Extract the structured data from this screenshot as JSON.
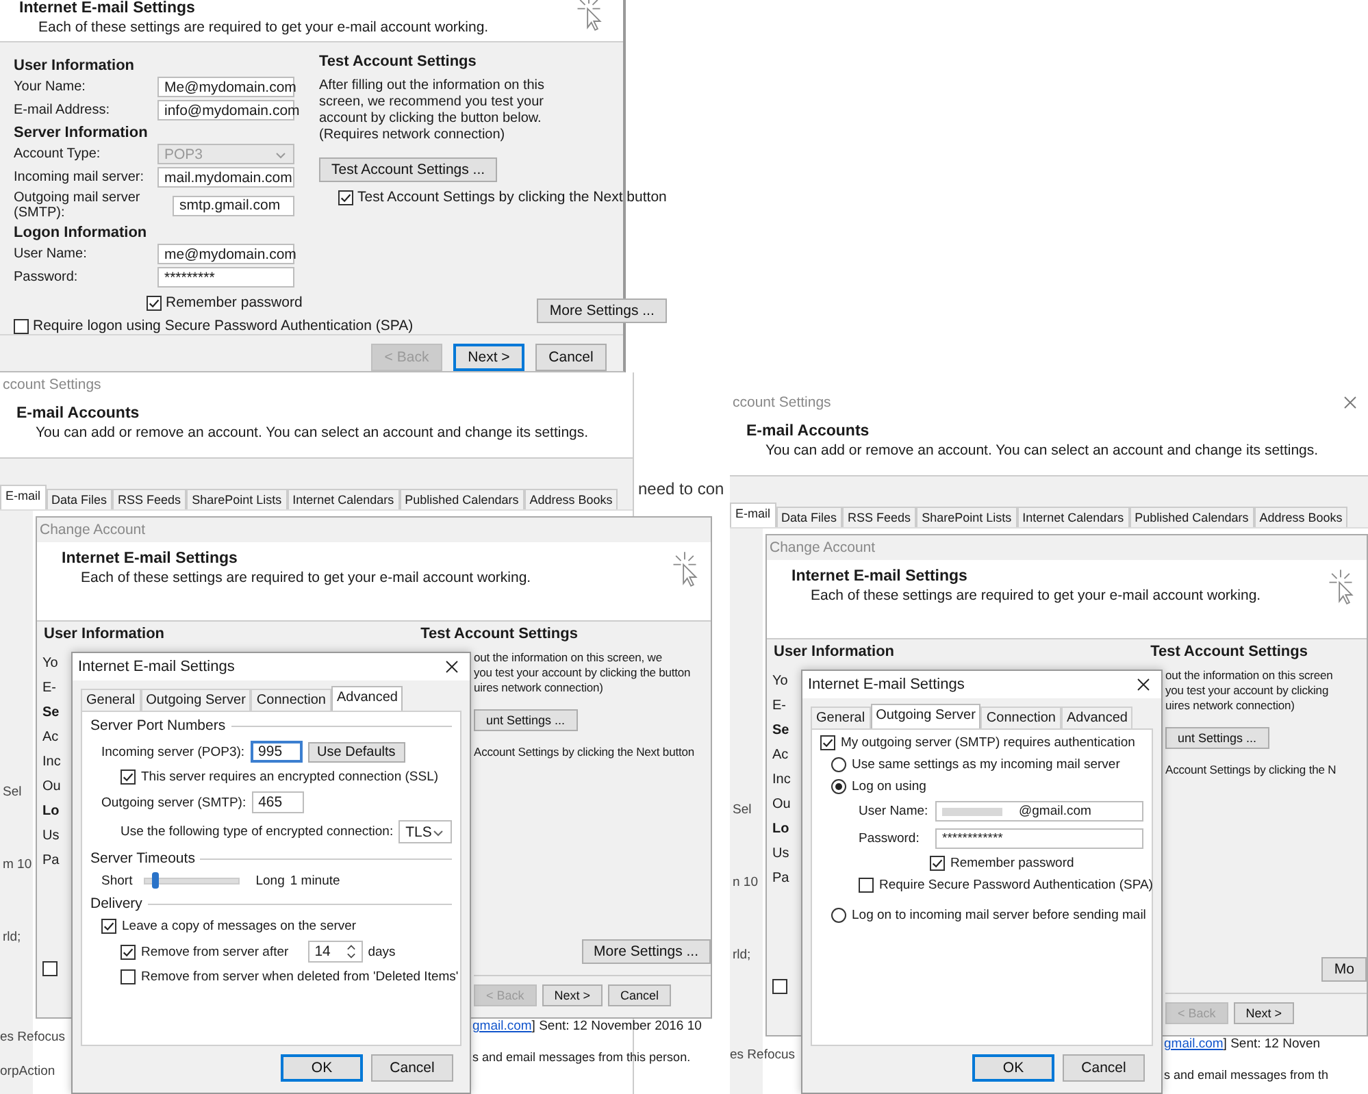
{
  "setup_dialog": {
    "heading": "Internet E-mail Settings",
    "description": "Each of these settings are required to get your e-mail account working.",
    "sections": [
      {
        "title": "User Information",
        "fields": [
          {
            "label": "Your Name:",
            "value": "Me@mydomain.com",
            "kind": "text",
            "disabled": false
          },
          {
            "label": "E-mail Address:",
            "value": "info@mydomain.com",
            "kind": "text",
            "disabled": false
          }
        ]
      },
      {
        "title": "Server Information",
        "fields": [
          {
            "label": "Account Type:",
            "value": "POP3",
            "kind": "select",
            "disabled": true
          },
          {
            "label": "Incoming mail server:",
            "value": "mail.mydomain.com",
            "kind": "text",
            "disabled": false
          },
          {
            "label": "Outgoing mail server (SMTP):",
            "value": "smtp.gmail.com",
            "kind": "text",
            "disabled": false
          }
        ]
      },
      {
        "title": "Logon Information",
        "fields": [
          {
            "label": "User Name:",
            "value": "me@mydomain.com",
            "kind": "text",
            "disabled": false
          },
          {
            "label": "Password:",
            "value": "*********",
            "kind": "text",
            "disabled": false
          }
        ]
      }
    ],
    "remember": {
      "label": "Remember password",
      "checked": true
    },
    "spa": {
      "label": "Require logon using Secure Password Authentication (SPA)",
      "checked": false
    },
    "test_title": "Test Account Settings",
    "test_text": "After filling out the information on this screen, we recommend you test your account by clicking the button below. (Requires network connection)",
    "test_button": "Test Account Settings ...",
    "test_check": {
      "label": "Test Account Settings by clicking the Next button",
      "checked": true
    },
    "more_button": "More Settings ...",
    "buttons": [
      {
        "label": "< Back",
        "disabled": true,
        "default": false
      },
      {
        "label": "Next >",
        "disabled": false,
        "default": true
      },
      {
        "label": "Cancel",
        "disabled": false,
        "default": false
      }
    ]
  },
  "scenes": [
    {
      "account_window": {
        "title": "ccount Settings",
        "close_button": false,
        "heading": "E-mail Accounts",
        "description": "You can add or remove an account. You can select an account and change its settings.",
        "tabs": [
          {
            "label": "E-mail",
            "selected": true
          },
          {
            "label": "Data Files",
            "selected": false
          },
          {
            "label": "RSS Feeds",
            "selected": false
          },
          {
            "label": "SharePoint Lists",
            "selected": false
          },
          {
            "label": "Internet Calendars",
            "selected": false
          },
          {
            "label": "Published Calendars",
            "selected": false
          },
          {
            "label": "Address Books",
            "selected": false
          }
        ],
        "side_fragments": [
          "Sel",
          "m 10",
          "rld;"
        ]
      },
      "aside_text": "need to con",
      "bottom_fragments": [
        "es Refocus",
        "orpAction"
      ],
      "change_window": {
        "title": "Change Account",
        "heading": "Internet E-mail Settings",
        "description": "Each of these settings are required to get your e-mail account working.",
        "left_heading": "User Information",
        "right_heading": "Test Account Settings",
        "label_fragments": [
          {
            "text": "Yo",
            "kind": "label"
          },
          {
            "text": "E-",
            "kind": "label"
          },
          {
            "text": "Se",
            "kind": "heading"
          },
          {
            "text": "Ac",
            "kind": "label"
          },
          {
            "text": "Inc",
            "kind": "label"
          },
          {
            "text": "Ou",
            "kind": "label"
          },
          {
            "text": "Lo",
            "kind": "heading"
          },
          {
            "text": "Us",
            "kind": "label"
          },
          {
            "text": "Pa",
            "kind": "label"
          }
        ],
        "spa_checkbox": {
          "checked": false
        },
        "test_lines": [
          "out the information on this screen, we",
          "you test your account by clicking the button",
          "uires network connection)"
        ],
        "test_button": "unt Settings ...",
        "test_check_label": "Account Settings by clicking the Next button",
        "more_button": "More Settings ...",
        "buttons": [
          {
            "label": "< Back",
            "disabled": true
          },
          {
            "label": "Next >",
            "disabled": false
          },
          {
            "label": "Cancel",
            "disabled": false
          }
        ]
      },
      "message": {
        "link": "gmail.com",
        "sent": "] Sent: 12 November 2016 10",
        "body": "s and email messages from this person."
      },
      "dialog": {
        "kind": "advanced",
        "title": "Internet E-mail Settings",
        "tabs": [
          {
            "label": "General",
            "selected": false
          },
          {
            "label": "Outgoing Server",
            "selected": false
          },
          {
            "label": "Connection",
            "selected": false
          },
          {
            "label": "Advanced",
            "selected": true
          }
        ],
        "content": {
          "ports_title": "Server Port Numbers",
          "incoming_label": "Incoming server (POP3):",
          "incoming_value": "995",
          "defaults_button": "Use Defaults",
          "ssl": {
            "label": "This server requires an encrypted connection (SSL)",
            "checked": true
          },
          "outgoing_label": "Outgoing server (SMTP):",
          "outgoing_value": "465",
          "encryption_label": "Use the following type of encrypted connection:",
          "encryption_value": "TLS",
          "timeouts_title": "Server Timeouts",
          "timeout_short": "Short",
          "timeout": {
            "level": 0.1
          },
          "timeout_long": "Long",
          "timeout_value": "1 minute",
          "delivery_title": "Delivery",
          "leave_copy": {
            "label": "Leave a copy of messages on the server",
            "checked": true
          },
          "remove_after": {
            "label": "Remove from server after",
            "checked": true
          },
          "days_value": "14",
          "days_label": "days",
          "remove_deleted": {
            "label": "Remove from server when deleted from 'Deleted Items'",
            "checked": false
          }
        },
        "buttons": [
          "OK",
          "Cancel"
        ]
      }
    },
    {
      "account_window": {
        "title": "ccount Settings",
        "close_button": true,
        "heading": "E-mail Accounts",
        "description": "You can add or remove an account. You can select an account and change its settings.",
        "tabs": [
          {
            "label": "E-mail",
            "selected": true
          },
          {
            "label": "Data Files",
            "selected": false
          },
          {
            "label": "RSS Feeds",
            "selected": false
          },
          {
            "label": "SharePoint Lists",
            "selected": false
          },
          {
            "label": "Internet Calendars",
            "selected": false
          },
          {
            "label": "Published Calendars",
            "selected": false
          },
          {
            "label": "Address Books",
            "selected": false
          }
        ],
        "side_fragments": [
          "Sel",
          "n 10",
          "rld;"
        ]
      },
      "bottom_fragments": [
        "es Refocus"
      ],
      "change_window": {
        "title": "Change Account",
        "heading": "Internet E-mail Settings",
        "description": "Each of these settings are required to get your e-mail account working.",
        "left_heading": "User Information",
        "right_heading": "Test Account Settings",
        "label_fragments": [
          {
            "text": "Yo",
            "kind": "label"
          },
          {
            "text": "E-",
            "kind": "label"
          },
          {
            "text": "Se",
            "kind": "heading"
          },
          {
            "text": "Ac",
            "kind": "label"
          },
          {
            "text": "Inc",
            "kind": "label"
          },
          {
            "text": "Ou",
            "kind": "label"
          },
          {
            "text": "Lo",
            "kind": "heading"
          },
          {
            "text": "Us",
            "kind": "label"
          },
          {
            "text": "Pa",
            "kind": "label"
          }
        ],
        "spa_checkbox": {
          "checked": false
        },
        "test_lines": [
          "out the information on this screen",
          "you test your account by clicking",
          "uires network connection)"
        ],
        "test_button": "unt Settings ...",
        "test_check_label": "Account Settings by clicking the N",
        "more_button": "Mo",
        "buttons": [
          {
            "label": "< Back",
            "disabled": true
          },
          {
            "label": "Next >",
            "disabled": false
          }
        ]
      },
      "message": {
        "link": "gmail.com",
        "sent": "] Sent: 12 Noven",
        "body": "s and email messages from th"
      },
      "dialog": {
        "kind": "outgoing",
        "title": "Internet E-mail Settings",
        "tabs": [
          {
            "label": "General",
            "selected": false
          },
          {
            "label": "Outgoing Server",
            "selected": true
          },
          {
            "label": "Connection",
            "selected": false
          },
          {
            "label": "Advanced",
            "selected": false
          }
        ],
        "content": {
          "auth": {
            "label": "My outgoing server (SMTP) requires authentication",
            "checked": true
          },
          "options": [
            {
              "label": "Use same settings as my incoming mail server",
              "selected": false,
              "kind": "plain"
            },
            {
              "label": "Log on using",
              "selected": true,
              "kind": "credentials"
            },
            {
              "label": "Log on to incoming mail server before sending mail",
              "selected": false,
              "kind": "plain"
            }
          ],
          "user_label": "User Name:",
          "user_value": "@gmail.com",
          "password_label": "Password:",
          "password_value": "************",
          "remember": {
            "label": "Remember password",
            "checked": true
          },
          "spa": {
            "label": "Require Secure Password Authentication (SPA)",
            "checked": false
          }
        },
        "buttons": [
          "OK",
          "Cancel"
        ]
      }
    }
  ]
}
